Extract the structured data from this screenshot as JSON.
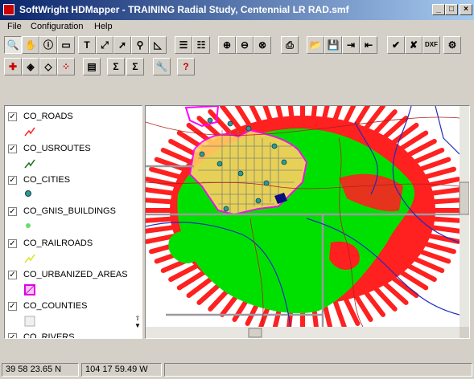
{
  "window": {
    "title": "SoftWright HDMapper - TRAINING Radial Study, Centennial LR RAD.smf"
  },
  "menu": [
    "File",
    "Configuration",
    "Help"
  ],
  "layers": [
    {
      "name": "CO_ROADS",
      "checked": true,
      "symbol": "line-red"
    },
    {
      "name": "CO_USROUTES",
      "checked": true,
      "symbol": "line-green"
    },
    {
      "name": "CO_CITIES",
      "checked": true,
      "symbol": "dot-teal"
    },
    {
      "name": "CO_GNIS_BUILDINGS",
      "checked": true,
      "symbol": "dot-green"
    },
    {
      "name": "CO_RAILROADS",
      "checked": true,
      "symbol": "line-yellow"
    },
    {
      "name": "CO_URBANIZED_AREAS",
      "checked": true,
      "symbol": "square-magenta"
    },
    {
      "name": "CO_COUNTIES",
      "checked": true,
      "symbol": "square-gray"
    },
    {
      "name": "CO_RIVERS",
      "checked": true,
      "symbol": "line-blue"
    }
  ],
  "status": {
    "latitude": "39 58 23.65 N",
    "longitude": "104 17 59.49 W"
  },
  "map": {
    "contour_colors": {
      "strong": "#00e000",
      "weak": "#ff1a1a",
      "urban": "#ff00ff",
      "county": "#9a9aa0",
      "river": "#1f2bc0"
    }
  }
}
